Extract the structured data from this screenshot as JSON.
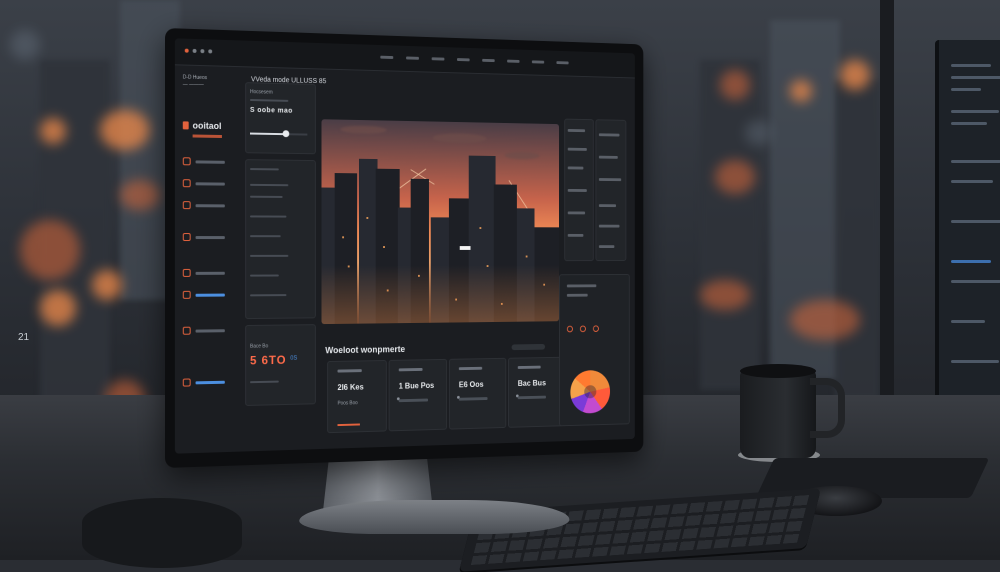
{
  "scene": {
    "description_items": [
      "monitor",
      "keyboard",
      "mouse",
      "mug",
      "city-bokeh-window"
    ]
  },
  "app": {
    "brand_line1": "D-D Hueos",
    "brand_line2": "— ———",
    "header_title": "VVeda mode ULLUSS 85",
    "logo_text": "ooitaol"
  },
  "sidebar": {
    "items": [
      {
        "icon": "cursor-icon"
      },
      {
        "icon": "flame-icon"
      },
      {
        "icon": "leaf-icon"
      },
      {
        "icon": "refresh-icon"
      },
      {
        "icon": "layers-icon"
      },
      {
        "icon": "bell-icon"
      },
      {
        "icon": "target-icon"
      },
      {
        "icon": "check-icon"
      }
    ]
  },
  "left_panel": {
    "heading": "Hocsesem",
    "sub": "S oobe mao",
    "stat": "5 6TO",
    "stat_unit": "0S",
    "stat_label": "Bace Bo"
  },
  "widgets": {
    "title": "Woeloot wonpmerte",
    "cards": [
      {
        "value": "2I6 Kes",
        "label": "Poos Boo"
      },
      {
        "value": "1 Bue Pos",
        "label": ""
      },
      {
        "value": "E6 Oos",
        "label": ""
      },
      {
        "value": "Bac Bus",
        "label": ""
      }
    ]
  },
  "colors": {
    "accent": "#e2623d",
    "blue": "#4c8fe0",
    "bg": "#1b1d21"
  },
  "side_number": "21"
}
